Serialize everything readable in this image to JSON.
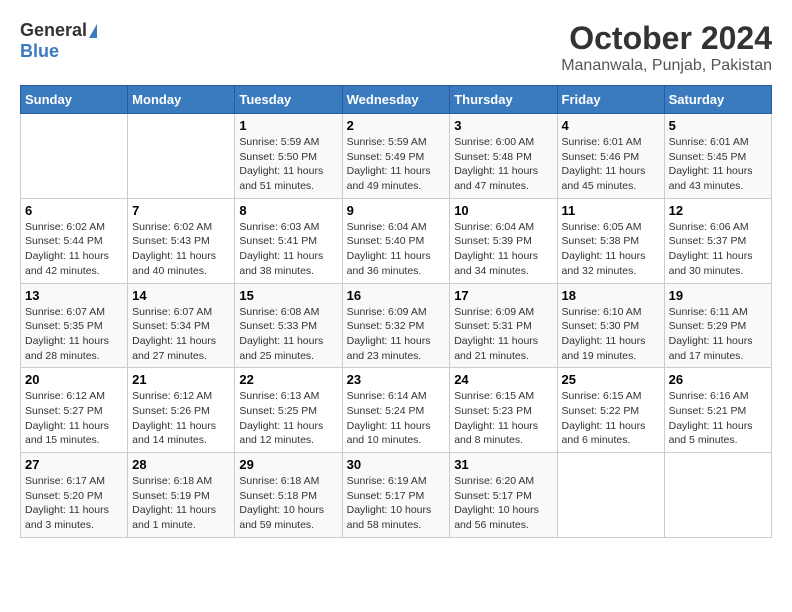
{
  "logo": {
    "general": "General",
    "blue": "Blue"
  },
  "title": {
    "month_year": "October 2024",
    "location": "Mananwala, Punjab, Pakistan"
  },
  "headers": [
    "Sunday",
    "Monday",
    "Tuesday",
    "Wednesday",
    "Thursday",
    "Friday",
    "Saturday"
  ],
  "weeks": [
    [
      {
        "day": "",
        "detail": ""
      },
      {
        "day": "",
        "detail": ""
      },
      {
        "day": "1",
        "detail": "Sunrise: 5:59 AM\nSunset: 5:50 PM\nDaylight: 11 hours and 51 minutes."
      },
      {
        "day": "2",
        "detail": "Sunrise: 5:59 AM\nSunset: 5:49 PM\nDaylight: 11 hours and 49 minutes."
      },
      {
        "day": "3",
        "detail": "Sunrise: 6:00 AM\nSunset: 5:48 PM\nDaylight: 11 hours and 47 minutes."
      },
      {
        "day": "4",
        "detail": "Sunrise: 6:01 AM\nSunset: 5:46 PM\nDaylight: 11 hours and 45 minutes."
      },
      {
        "day": "5",
        "detail": "Sunrise: 6:01 AM\nSunset: 5:45 PM\nDaylight: 11 hours and 43 minutes."
      }
    ],
    [
      {
        "day": "6",
        "detail": "Sunrise: 6:02 AM\nSunset: 5:44 PM\nDaylight: 11 hours and 42 minutes."
      },
      {
        "day": "7",
        "detail": "Sunrise: 6:02 AM\nSunset: 5:43 PM\nDaylight: 11 hours and 40 minutes."
      },
      {
        "day": "8",
        "detail": "Sunrise: 6:03 AM\nSunset: 5:41 PM\nDaylight: 11 hours and 38 minutes."
      },
      {
        "day": "9",
        "detail": "Sunrise: 6:04 AM\nSunset: 5:40 PM\nDaylight: 11 hours and 36 minutes."
      },
      {
        "day": "10",
        "detail": "Sunrise: 6:04 AM\nSunset: 5:39 PM\nDaylight: 11 hours and 34 minutes."
      },
      {
        "day": "11",
        "detail": "Sunrise: 6:05 AM\nSunset: 5:38 PM\nDaylight: 11 hours and 32 minutes."
      },
      {
        "day": "12",
        "detail": "Sunrise: 6:06 AM\nSunset: 5:37 PM\nDaylight: 11 hours and 30 minutes."
      }
    ],
    [
      {
        "day": "13",
        "detail": "Sunrise: 6:07 AM\nSunset: 5:35 PM\nDaylight: 11 hours and 28 minutes."
      },
      {
        "day": "14",
        "detail": "Sunrise: 6:07 AM\nSunset: 5:34 PM\nDaylight: 11 hours and 27 minutes."
      },
      {
        "day": "15",
        "detail": "Sunrise: 6:08 AM\nSunset: 5:33 PM\nDaylight: 11 hours and 25 minutes."
      },
      {
        "day": "16",
        "detail": "Sunrise: 6:09 AM\nSunset: 5:32 PM\nDaylight: 11 hours and 23 minutes."
      },
      {
        "day": "17",
        "detail": "Sunrise: 6:09 AM\nSunset: 5:31 PM\nDaylight: 11 hours and 21 minutes."
      },
      {
        "day": "18",
        "detail": "Sunrise: 6:10 AM\nSunset: 5:30 PM\nDaylight: 11 hours and 19 minutes."
      },
      {
        "day": "19",
        "detail": "Sunrise: 6:11 AM\nSunset: 5:29 PM\nDaylight: 11 hours and 17 minutes."
      }
    ],
    [
      {
        "day": "20",
        "detail": "Sunrise: 6:12 AM\nSunset: 5:27 PM\nDaylight: 11 hours and 15 minutes."
      },
      {
        "day": "21",
        "detail": "Sunrise: 6:12 AM\nSunset: 5:26 PM\nDaylight: 11 hours and 14 minutes."
      },
      {
        "day": "22",
        "detail": "Sunrise: 6:13 AM\nSunset: 5:25 PM\nDaylight: 11 hours and 12 minutes."
      },
      {
        "day": "23",
        "detail": "Sunrise: 6:14 AM\nSunset: 5:24 PM\nDaylight: 11 hours and 10 minutes."
      },
      {
        "day": "24",
        "detail": "Sunrise: 6:15 AM\nSunset: 5:23 PM\nDaylight: 11 hours and 8 minutes."
      },
      {
        "day": "25",
        "detail": "Sunrise: 6:15 AM\nSunset: 5:22 PM\nDaylight: 11 hours and 6 minutes."
      },
      {
        "day": "26",
        "detail": "Sunrise: 6:16 AM\nSunset: 5:21 PM\nDaylight: 11 hours and 5 minutes."
      }
    ],
    [
      {
        "day": "27",
        "detail": "Sunrise: 6:17 AM\nSunset: 5:20 PM\nDaylight: 11 hours and 3 minutes."
      },
      {
        "day": "28",
        "detail": "Sunrise: 6:18 AM\nSunset: 5:19 PM\nDaylight: 11 hours and 1 minute."
      },
      {
        "day": "29",
        "detail": "Sunrise: 6:18 AM\nSunset: 5:18 PM\nDaylight: 10 hours and 59 minutes."
      },
      {
        "day": "30",
        "detail": "Sunrise: 6:19 AM\nSunset: 5:17 PM\nDaylight: 10 hours and 58 minutes."
      },
      {
        "day": "31",
        "detail": "Sunrise: 6:20 AM\nSunset: 5:17 PM\nDaylight: 10 hours and 56 minutes."
      },
      {
        "day": "",
        "detail": ""
      },
      {
        "day": "",
        "detail": ""
      }
    ]
  ]
}
